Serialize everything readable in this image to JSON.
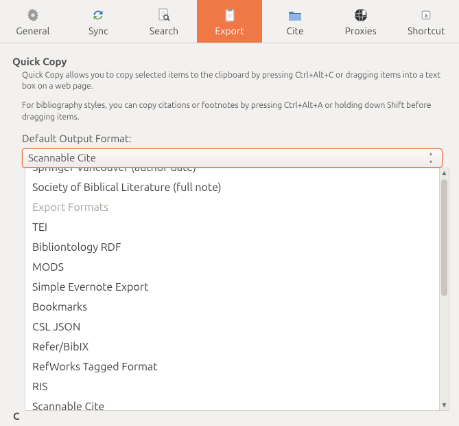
{
  "toolbar": {
    "items": [
      {
        "label": "General"
      },
      {
        "label": "Sync"
      },
      {
        "label": "Search"
      },
      {
        "label": "Export"
      },
      {
        "label": "Cite"
      },
      {
        "label": "Proxies"
      },
      {
        "label": "Shortcut"
      }
    ]
  },
  "quickcopy": {
    "title": "Quick Copy",
    "desc1": "Quick Copy allows you to copy selected items to the clipboard by pressing Ctrl+Alt+C or dragging items into a text box on a web page.",
    "desc2": "For bibliography styles, you can copy citations or footnotes by pressing Ctrl+Alt+A or holding down Shift before dragging items.",
    "field_label": "Default Output Format:",
    "selected": "Scannable Cite"
  },
  "dropdown": {
    "clipped_top": "Springer Vancouver (author-date)",
    "group1": [
      "Society of Biblical Literature (full note)"
    ],
    "header": "Export Formats",
    "group2": [
      "TEI",
      "Bibliontology RDF",
      "MODS",
      "Simple Evernote Export",
      "Bookmarks",
      "CSL JSON",
      "Refer/BibIX",
      "RefWorks Tagged Format",
      "RIS",
      "Scannable Cite"
    ]
  },
  "partial_heading": "C"
}
